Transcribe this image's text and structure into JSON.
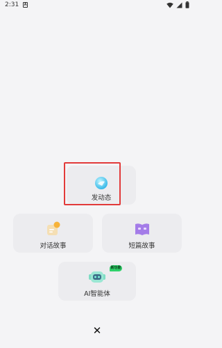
{
  "status_bar": {
    "time": "2:31",
    "notif_glyph": "A"
  },
  "menu": {
    "post": {
      "label": "发动态"
    },
    "dialogue_story": {
      "label": "对话故事"
    },
    "short_story": {
      "label": "短篇故事"
    },
    "ai_agent": {
      "label": "AI智能体",
      "badge": "新功能"
    }
  },
  "close": {
    "glyph": "✕"
  },
  "colors": {
    "highlight": "#e23a3a",
    "badge": "#2fd16a",
    "card": "#ececef"
  }
}
